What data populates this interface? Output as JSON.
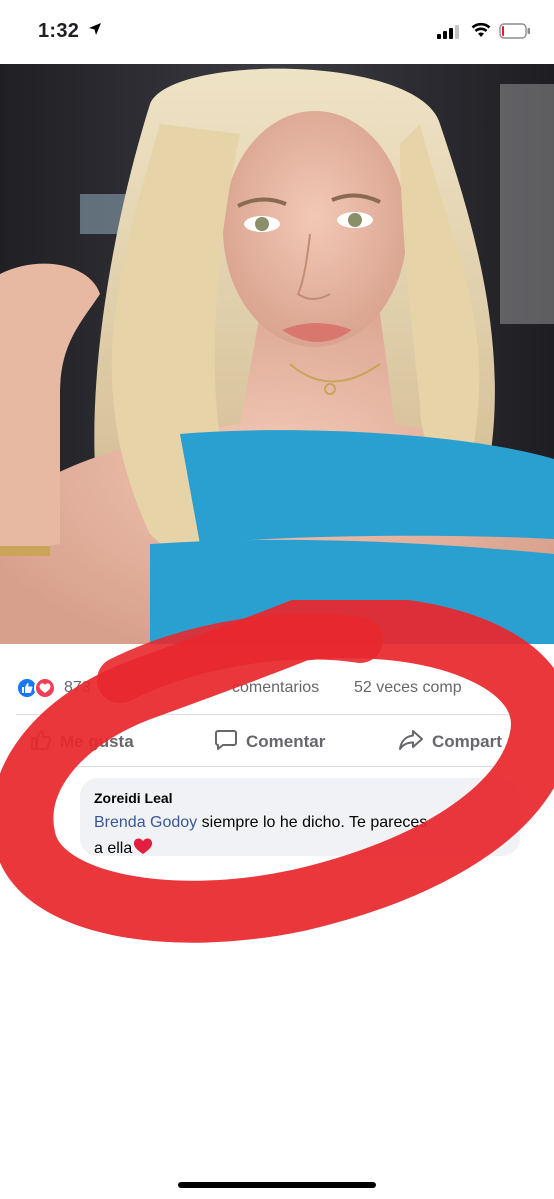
{
  "status_bar": {
    "time": "1:32"
  },
  "post": {
    "reactions_count": "873",
    "comments_count": "comentarios",
    "shares_count": "52 veces comp"
  },
  "actions": {
    "like_label": "Me gusta",
    "comment_label": "Comentar",
    "share_label": "Compart"
  },
  "comment": {
    "author": "Zoreidi Leal",
    "mention": "Brenda Godoy",
    "text_1": " siempre lo he dicho. Te pareces",
    "text_2": "a ella"
  },
  "colors": {
    "like_blue": "#1877f2",
    "love_red": "#f33e58",
    "mention_blue": "#385898",
    "scribble_red": "#e8282d",
    "dress_blue": "#2aa0d0"
  },
  "icons": [
    "location-arrow-icon",
    "cell-signal-icon",
    "wifi-icon",
    "battery-icon",
    "like-reaction-icon",
    "love-reaction-icon",
    "thumb-up-icon",
    "comment-icon",
    "share-icon",
    "heart-emoji-icon"
  ]
}
